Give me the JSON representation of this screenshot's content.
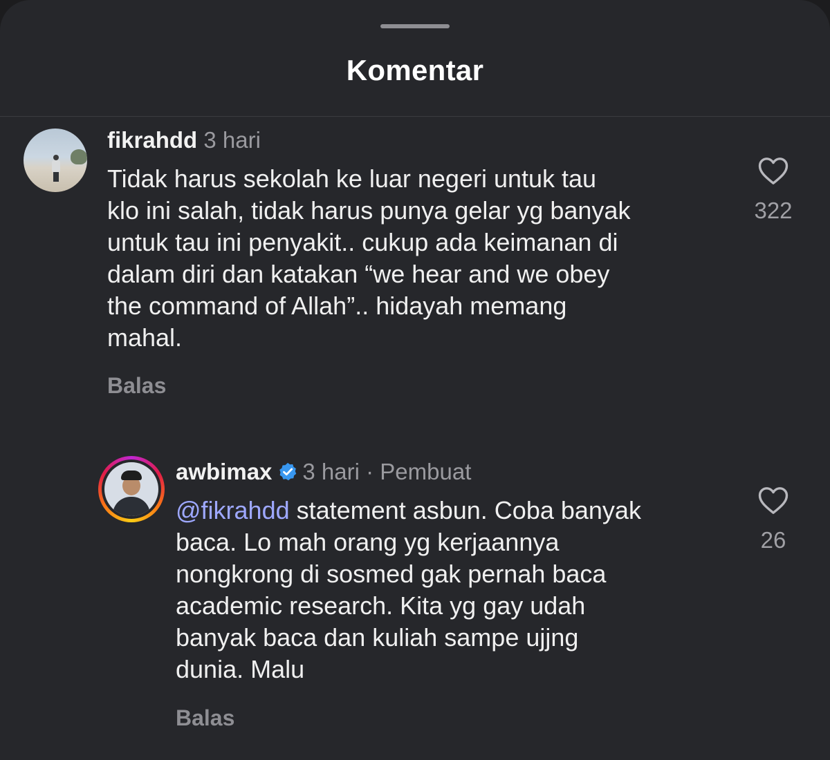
{
  "header": {
    "title": "Komentar"
  },
  "comments": [
    {
      "username": "fikrahdd",
      "time": "3 hari",
      "lines": [
        "Tidak harus sekolah ke luar negeri untuk tau",
        "klo ini salah, tidak harus punya gelar yg banyak",
        "untuk tau ini penyakit.. cukup ada keimanan di",
        "dalam diri dan katakan “we hear and we obey",
        "the command of Allah”.. hidayah memang",
        "mahal."
      ],
      "reply_label": "Balas",
      "likes": "322",
      "like_icon": "heart-outline-icon"
    },
    {
      "username": "awbimax",
      "verified_icon": "verified-badge-icon",
      "time": "3 hari",
      "creator_tag": "· Pembuat",
      "mention": "@fikrahdd",
      "first_line_rest": " statement asbun. Coba banyak",
      "lines": [
        "baca. Lo mah orang yg kerjaannya",
        "nongkrong di sosmed gak pernah baca",
        "academic research. Kita yg gay udah",
        "banyak baca dan kuliah sampe ujjng",
        "dunia. Malu"
      ],
      "reply_label": "Balas",
      "likes": "26",
      "like_icon": "heart-outline-icon"
    }
  ],
  "colors": {
    "background": "#26272b",
    "mention": "#9ea8ff",
    "verified": "#3897f0",
    "muted": "#9a9a9f"
  }
}
